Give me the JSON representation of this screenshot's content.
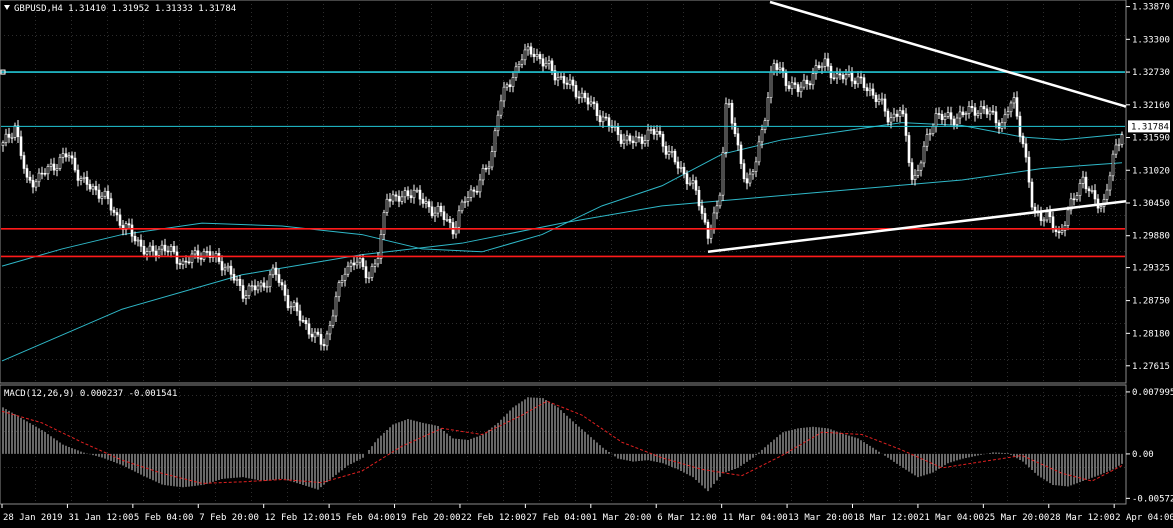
{
  "chart_data": [
    {
      "type": "candlestick",
      "title": "GBPUSD,H4  1.31410 1.31952 1.31333 1.31784",
      "symbol": "GBPUSD",
      "timeframe": "H4",
      "ohlc_readout": {
        "open": 1.3141,
        "high": 1.31952,
        "low": 1.31333,
        "close": 1.31784
      },
      "current_price": "1.31784",
      "ylim": [
        1.2735,
        1.3395
      ],
      "y_ticks": [
        "1.33870",
        "1.33300",
        "1.32730",
        "1.32160",
        "1.31590",
        "1.31020",
        "1.30450",
        "1.29880",
        "1.29325",
        "1.28750",
        "1.28180",
        "1.27615"
      ],
      "x_ticks": [
        "28 Jan 2019",
        "31 Jan 12:00",
        "5 Feb 04:00",
        "7 Feb 20:00",
        "12 Feb 12:00",
        "15 Feb 04:00",
        "19 Feb 20:00",
        "22 Feb 12:00",
        "27 Feb 04:00",
        "1 Mar 20:00",
        "6 Mar 12:00",
        "11 Mar 04:00",
        "13 Mar 20:00",
        "18 Mar 12:00",
        "21 Mar 04:00",
        "25 Mar 20:00",
        "28 Mar 12:00",
        "2 Apr 04:00"
      ],
      "grid": true,
      "close_path": [
        [
          0,
          1.3145
        ],
        [
          12,
          1.318
        ],
        [
          24,
          1.308
        ],
        [
          36,
          1.309
        ],
        [
          50,
          1.311
        ],
        [
          65,
          1.313
        ],
        [
          80,
          1.308
        ],
        [
          100,
          1.306
        ],
        [
          118,
          1.301
        ],
        [
          132,
          1.2985
        ],
        [
          145,
          1.2955
        ],
        [
          160,
          1.297
        ],
        [
          180,
          1.294
        ],
        [
          200,
          1.296
        ],
        [
          220,
          1.294
        ],
        [
          240,
          1.289
        ],
        [
          258,
          1.29
        ],
        [
          272,
          1.2925
        ],
        [
          286,
          1.287
        ],
        [
          300,
          1.284
        ],
        [
          312,
          1.281
        ],
        [
          322,
          1.28
        ],
        [
          332,
          1.287
        ],
        [
          342,
          1.293
        ],
        [
          352,
          1.2945
        ],
        [
          366,
          1.292
        ],
        [
          376,
          1.2955
        ],
        [
          384,
          1.306
        ],
        [
          398,
          1.305
        ],
        [
          410,
          1.307
        ],
        [
          422,
          1.304
        ],
        [
          436,
          1.303
        ],
        [
          450,
          1.3
        ],
        [
          462,
          1.305
        ],
        [
          476,
          1.308
        ],
        [
          488,
          1.312
        ],
        [
          496,
          1.322
        ],
        [
          506,
          1.325
        ],
        [
          518,
          1.33
        ],
        [
          530,
          1.331
        ],
        [
          540,
          1.329
        ],
        [
          552,
          1.327
        ],
        [
          566,
          1.325
        ],
        [
          580,
          1.323
        ],
        [
          596,
          1.32
        ],
        [
          612,
          1.317
        ],
        [
          626,
          1.315
        ],
        [
          640,
          1.316
        ],
        [
          654,
          1.317
        ],
        [
          666,
          1.313
        ],
        [
          680,
          1.31
        ],
        [
          694,
          1.306
        ],
        [
          705,
          1.299
        ],
        [
          716,
          1.304
        ],
        [
          724,
          1.324
        ],
        [
          734,
          1.314
        ],
        [
          744,
          1.308
        ],
        [
          754,
          1.312
        ],
        [
          762,
          1.32
        ],
        [
          770,
          1.329
        ],
        [
          782,
          1.326
        ],
        [
          796,
          1.324
        ],
        [
          810,
          1.327
        ],
        [
          822,
          1.329
        ],
        [
          834,
          1.326
        ],
        [
          846,
          1.327
        ],
        [
          860,
          1.325
        ],
        [
          874,
          1.323
        ],
        [
          886,
          1.319
        ],
        [
          898,
          1.321
        ],
        [
          910,
          1.308
        ],
        [
          920,
          1.313
        ],
        [
          932,
          1.32
        ],
        [
          946,
          1.319
        ],
        [
          960,
          1.32
        ],
        [
          974,
          1.321
        ],
        [
          988,
          1.32
        ],
        [
          1000,
          1.318
        ],
        [
          1010,
          1.323
        ],
        [
          1020,
          1.315
        ],
        [
          1030,
          1.303
        ],
        [
          1044,
          1.302
        ],
        [
          1056,
          1.299
        ],
        [
          1068,
          1.304
        ],
        [
          1080,
          1.309
        ],
        [
          1090,
          1.305
        ],
        [
          1100,
          1.304
        ],
        [
          1110,
          1.312
        ],
        [
          1120,
          1.3178
        ]
      ],
      "moving_averages": [
        {
          "points": [
            [
              0,
              1.2935
            ],
            [
              60,
              1.2965
            ],
            [
              120,
              1.299
            ],
            [
              200,
              1.301
            ],
            [
              280,
              1.3005
            ],
            [
              360,
              1.299
            ],
            [
              420,
              1.2965
            ],
            [
              480,
              1.296
            ],
            [
              540,
              1.299
            ],
            [
              600,
              1.304
            ],
            [
              660,
              1.3075
            ],
            [
              720,
              1.313
            ],
            [
              780,
              1.3155
            ],
            [
              840,
              1.317
            ],
            [
              900,
              1.3185
            ],
            [
              960,
              1.318
            ],
            [
              1020,
              1.316
            ],
            [
              1060,
              1.3155
            ],
            [
              1120,
              1.3165
            ]
          ]
        },
        {
          "points": [
            [
              0,
              1.277
            ],
            [
              120,
              1.286
            ],
            [
              240,
              1.292
            ],
            [
              360,
              1.2955
            ],
            [
              460,
              1.2975
            ],
            [
              560,
              1.301
            ],
            [
              660,
              1.304
            ],
            [
              760,
              1.3055
            ],
            [
              860,
              1.307
            ],
            [
              960,
              1.3085
            ],
            [
              1040,
              1.3105
            ],
            [
              1120,
              1.3115
            ]
          ]
        }
      ],
      "horizontal_levels": [
        {
          "price": 1.3273,
          "color": "#22c7d6"
        },
        {
          "price": 1.31784,
          "color": "#22c7d6"
        },
        {
          "price": 1.3,
          "color": "#ff1a1a"
        },
        {
          "price": 1.2952,
          "color": "#ff1a1a"
        }
      ],
      "trendlines": [
        {
          "from": [
            768,
            1.3395
          ],
          "to": [
            1124,
            1.3213
          ],
          "color": "#ffffff"
        },
        {
          "from": [
            706,
            1.296
          ],
          "to": [
            1124,
            1.3048
          ],
          "color": "#ffffff"
        }
      ]
    },
    {
      "type": "histogram",
      "title": "MACD(12,26,9) 0.000237 -0.001541",
      "indicator": "MACD",
      "params": [
        12,
        26,
        9
      ],
      "main": 0.000237,
      "signal": -0.001541,
      "ylim": [
        -0.0062,
        0.0085
      ],
      "y_ticks": [
        "0.007995",
        "0.00",
        "-0.005727"
      ],
      "main_path": [
        [
          0,
          0.006
        ],
        [
          20,
          0.0045
        ],
        [
          40,
          0.003
        ],
        [
          60,
          0.0012
        ],
        [
          80,
          0.0002
        ],
        [
          100,
          -0.0005
        ],
        [
          120,
          -0.0015
        ],
        [
          140,
          -0.0028
        ],
        [
          160,
          -0.004
        ],
        [
          180,
          -0.0043
        ],
        [
          200,
          -0.004
        ],
        [
          220,
          -0.0032
        ],
        [
          240,
          -0.003
        ],
        [
          260,
          -0.0035
        ],
        [
          280,
          -0.0032
        ],
        [
          300,
          -0.004
        ],
        [
          315,
          -0.0046
        ],
        [
          330,
          -0.003
        ],
        [
          345,
          -0.0015
        ],
        [
          360,
          -0.0005
        ],
        [
          375,
          0.002
        ],
        [
          390,
          0.0038
        ],
        [
          405,
          0.0045
        ],
        [
          420,
          0.004
        ],
        [
          435,
          0.0036
        ],
        [
          450,
          0.002
        ],
        [
          465,
          0.0018
        ],
        [
          480,
          0.0025
        ],
        [
          495,
          0.004
        ],
        [
          510,
          0.006
        ],
        [
          525,
          0.0073
        ],
        [
          540,
          0.0072
        ],
        [
          555,
          0.006
        ],
        [
          570,
          0.0042
        ],
        [
          585,
          0.0025
        ],
        [
          600,
          0.0008
        ],
        [
          615,
          -0.0006
        ],
        [
          630,
          -0.001
        ],
        [
          645,
          -0.0008
        ],
        [
          660,
          -0.0012
        ],
        [
          675,
          -0.002
        ],
        [
          690,
          -0.003
        ],
        [
          705,
          -0.0048
        ],
        [
          720,
          -0.0025
        ],
        [
          735,
          -0.0018
        ],
        [
          750,
          -0.0005
        ],
        [
          765,
          0.0012
        ],
        [
          780,
          0.0028
        ],
        [
          795,
          0.0033
        ],
        [
          810,
          0.0035
        ],
        [
          825,
          0.0033
        ],
        [
          840,
          0.0026
        ],
        [
          855,
          0.002
        ],
        [
          870,
          0.0008
        ],
        [
          885,
          -0.0005
        ],
        [
          900,
          -0.0018
        ],
        [
          915,
          -0.003
        ],
        [
          930,
          -0.0024
        ],
        [
          945,
          -0.0012
        ],
        [
          960,
          -0.0006
        ],
        [
          975,
          -0.0002
        ],
        [
          990,
          0.0002
        ],
        [
          1005,
          0.0001
        ],
        [
          1020,
          -0.001
        ],
        [
          1035,
          -0.0028
        ],
        [
          1050,
          -0.004
        ],
        [
          1065,
          -0.0042
        ],
        [
          1080,
          -0.0035
        ],
        [
          1095,
          -0.0028
        ],
        [
          1110,
          -0.002
        ],
        [
          1120,
          -0.0012
        ]
      ],
      "signal_path": [
        [
          0,
          0.0055
        ],
        [
          40,
          0.004
        ],
        [
          80,
          0.0015
        ],
        [
          120,
          -0.0008
        ],
        [
          160,
          -0.0025
        ],
        [
          200,
          -0.0038
        ],
        [
          240,
          -0.0036
        ],
        [
          280,
          -0.0033
        ],
        [
          320,
          -0.0037
        ],
        [
          360,
          -0.0022
        ],
        [
          400,
          0.001
        ],
        [
          440,
          0.0033
        ],
        [
          480,
          0.0025
        ],
        [
          520,
          0.005
        ],
        [
          545,
          0.0068
        ],
        [
          580,
          0.005
        ],
        [
          620,
          0.0015
        ],
        [
          660,
          -0.0005
        ],
        [
          700,
          -0.002
        ],
        [
          740,
          -0.0028
        ],
        [
          780,
          -0.0002
        ],
        [
          820,
          0.0028
        ],
        [
          860,
          0.0025
        ],
        [
          900,
          0.0005
        ],
        [
          940,
          -0.0018
        ],
        [
          980,
          -0.001
        ],
        [
          1020,
          -0.0002
        ],
        [
          1060,
          -0.0025
        ],
        [
          1090,
          -0.0035
        ],
        [
          1120,
          -0.0015
        ]
      ]
    }
  ]
}
